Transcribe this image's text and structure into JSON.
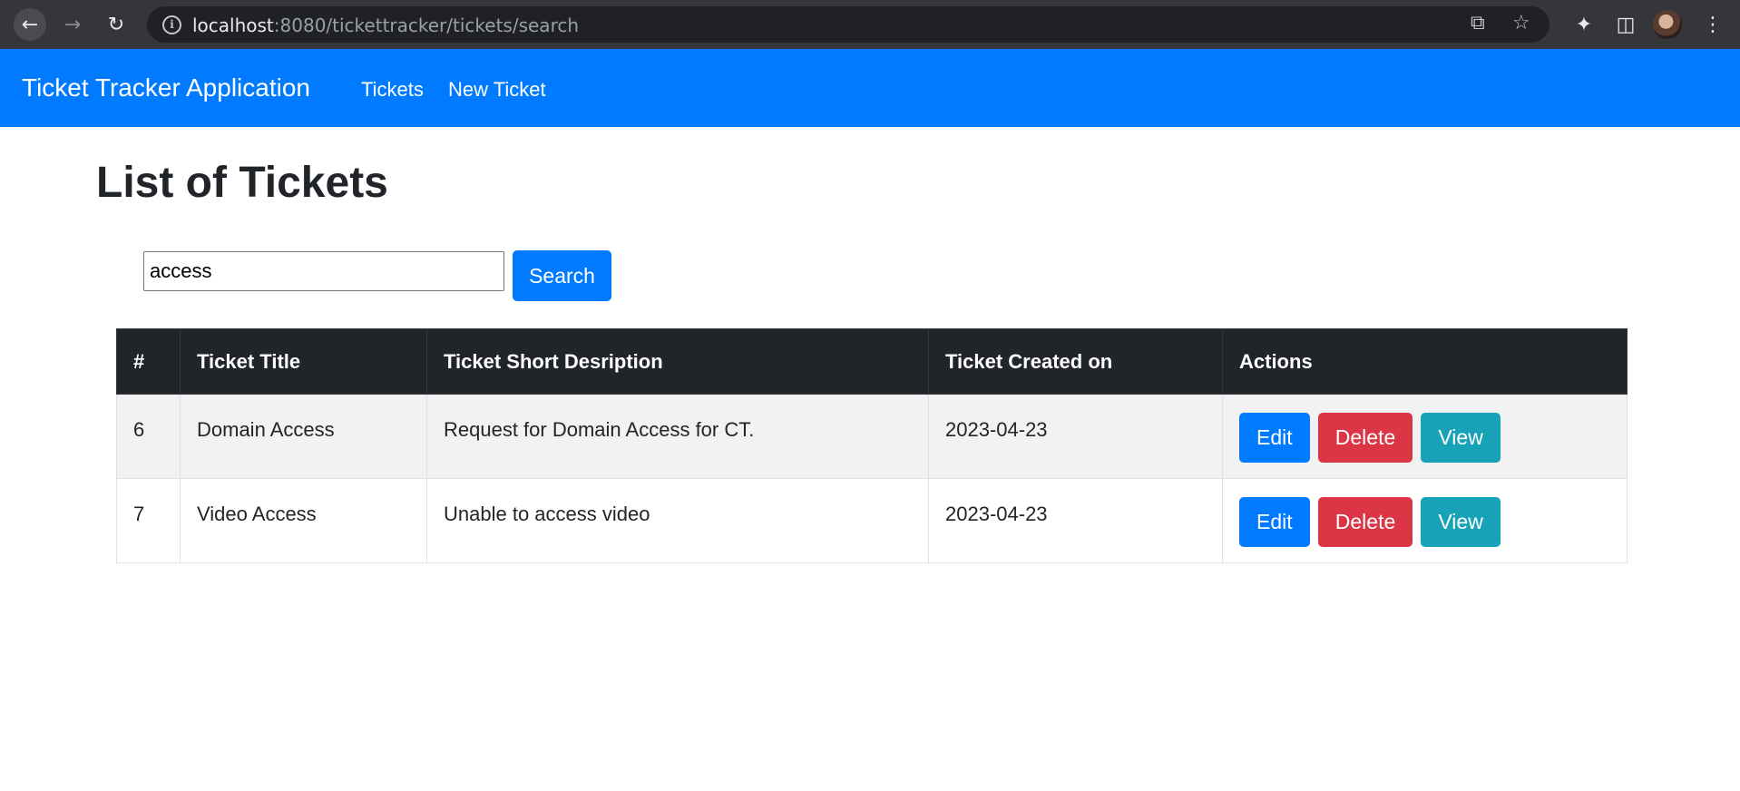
{
  "browser": {
    "url_host": "localhost",
    "url_path": ":8080/tickettracker/tickets/search",
    "icons": [
      "back-arrow-icon",
      "forward-arrow-icon",
      "reload-icon",
      "info-icon",
      "share-icon",
      "star-icon",
      "extensions-icon",
      "side-panel-icon",
      "menu-icon"
    ]
  },
  "navbar": {
    "brand": "Ticket Tracker Application",
    "links": [
      "Tickets",
      "New Ticket"
    ],
    "color": "#007bff"
  },
  "page": {
    "title": "List of Tickets"
  },
  "search": {
    "value": "access",
    "button_label": "Search"
  },
  "table": {
    "headers": [
      "#",
      "Ticket Title",
      "Ticket Short Desription",
      "Ticket Created on",
      "Actions"
    ],
    "rows": [
      {
        "id": "6",
        "title": "Domain Access",
        "description": "Request for Domain Access for CT.",
        "created": "2023-04-23"
      },
      {
        "id": "7",
        "title": "Video Access",
        "description": "Unable to access video",
        "created": "2023-04-23"
      }
    ],
    "actions": {
      "edit": "Edit",
      "delete": "Delete",
      "view": "View"
    }
  },
  "colors": {
    "primary": "#007bff",
    "danger": "#dc3545",
    "info": "#17a2b8",
    "dark": "#212529"
  }
}
